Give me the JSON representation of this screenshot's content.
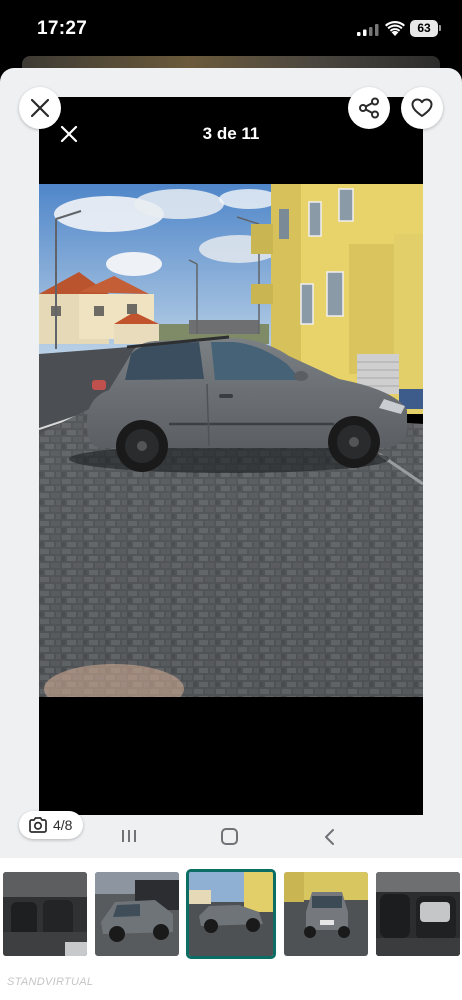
{
  "status_bar": {
    "time": "17:27",
    "battery": "63"
  },
  "viewer": {
    "counter": "3 de 11"
  },
  "gallery": {
    "photo_count": "4/8"
  },
  "icons": {
    "close": "close-icon",
    "share": "share-icon",
    "favorite": "heart-icon",
    "camera": "camera-icon",
    "recent_apps": "recent-apps-icon",
    "home": "home-icon",
    "back": "back-icon"
  },
  "thumbnails": [
    {
      "subject": "car-interior-front-seats",
      "selected": false
    },
    {
      "subject": "car-exterior-grey-hatchback",
      "selected": false
    },
    {
      "subject": "car-side-view-parked",
      "selected": true
    },
    {
      "subject": "car-rear-view",
      "selected": false
    },
    {
      "subject": "car-interior-rear-seats",
      "selected": false
    }
  ],
  "watermark": "STANDVIRTUAL",
  "colors": {
    "accent": "#0b6d64",
    "sheet": "#eef0f2"
  }
}
